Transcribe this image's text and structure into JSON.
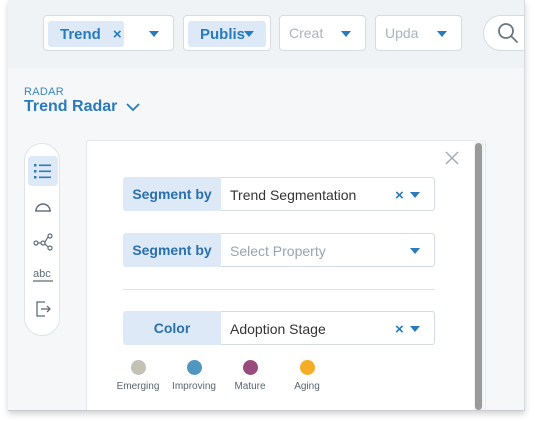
{
  "filters": [
    {
      "label": "Trend",
      "has_clear": true
    },
    {
      "label": "Publis",
      "has_clear": false
    },
    {
      "placeholder": "Creat"
    },
    {
      "placeholder": "Upda"
    }
  ],
  "search": {
    "icon": "search-icon"
  },
  "radar": {
    "section_label": "RADAR",
    "title": "Trend Radar"
  },
  "toolbar": {
    "items": [
      {
        "name": "list-icon",
        "active": true
      },
      {
        "name": "radar-arc-icon"
      },
      {
        "name": "network-icon"
      },
      {
        "name": "abc-text-icon"
      },
      {
        "name": "export-icon"
      }
    ]
  },
  "panel": {
    "rows": [
      {
        "label": "Segment by",
        "value": "Trend Segmentation",
        "placeholder": false,
        "clearable": true
      },
      {
        "label": "Segment by",
        "value": "Select Property",
        "placeholder": true,
        "clearable": false
      },
      {
        "label": "Color",
        "value": "Adoption Stage",
        "placeholder": false,
        "clearable": true
      }
    ],
    "legend": [
      {
        "label": "Emerging",
        "color": "#c3c2b4"
      },
      {
        "label": "Improving",
        "color": "#4f97bf"
      },
      {
        "label": "Mature",
        "color": "#9a4b7e"
      },
      {
        "label": "Aging",
        "color": "#f5ad28"
      }
    ]
  },
  "colors": {
    "accent": "#2a7bbb",
    "chip_bg": "#dde9f6"
  }
}
